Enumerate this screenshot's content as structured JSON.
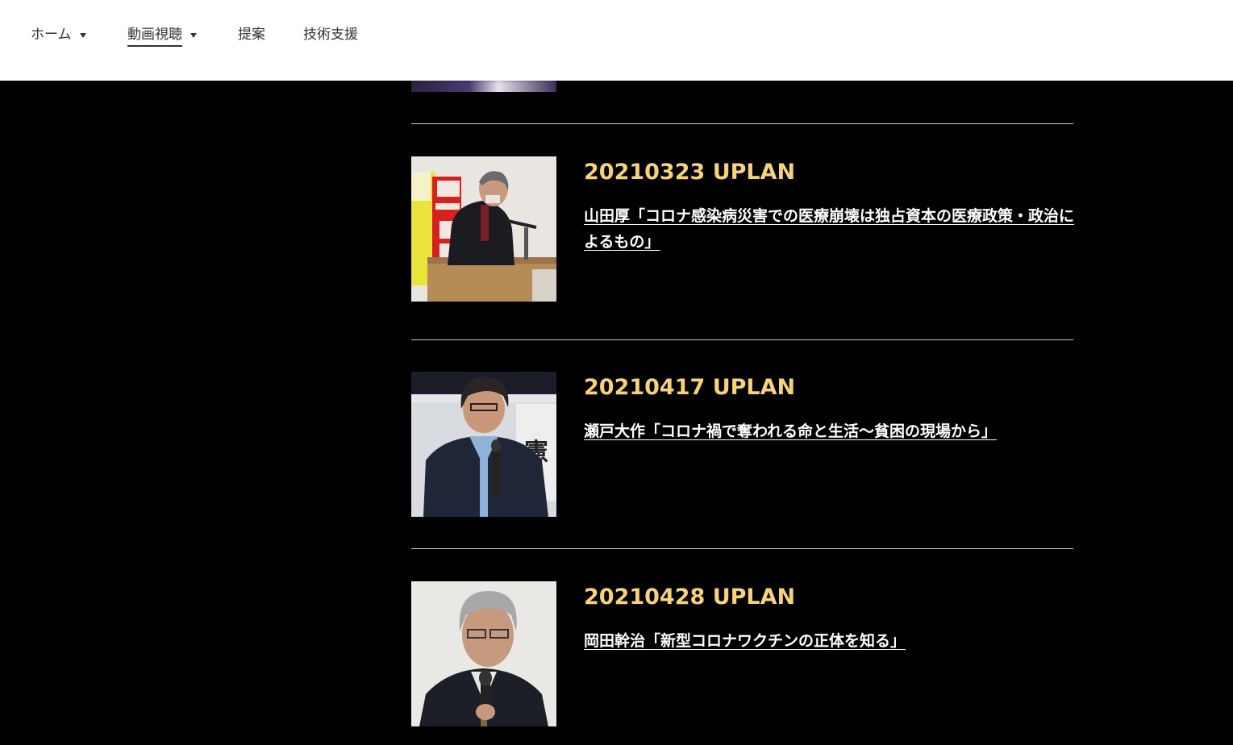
{
  "nav": {
    "items": [
      {
        "label": "ホーム",
        "has_dropdown": true
      },
      {
        "label": "動画視聴",
        "has_dropdown": true,
        "active": true
      },
      {
        "label": "提案",
        "has_dropdown": false
      },
      {
        "label": "技術支援",
        "has_dropdown": false
      }
    ]
  },
  "colors": {
    "background": "#000000",
    "date_text": "#f6d27a",
    "title_text": "#ffffff",
    "divider": "#cfcfcf",
    "nav_bg": "#ffffff"
  },
  "entries": [
    {
      "date": "20210323 UPLAN",
      "title": "山田厚「コロナ感染病災害での医療崩壊は独占資本の医療政策・政治によるもの」"
    },
    {
      "date": "20210417 UPLAN",
      "title": "瀬戸大作「コロナ禍で奪われる命と生活～貧困の現場から」"
    },
    {
      "date": "20210428 UPLAN",
      "title": "岡田幹治「新型コロナワクチンの正体を知る」"
    }
  ]
}
